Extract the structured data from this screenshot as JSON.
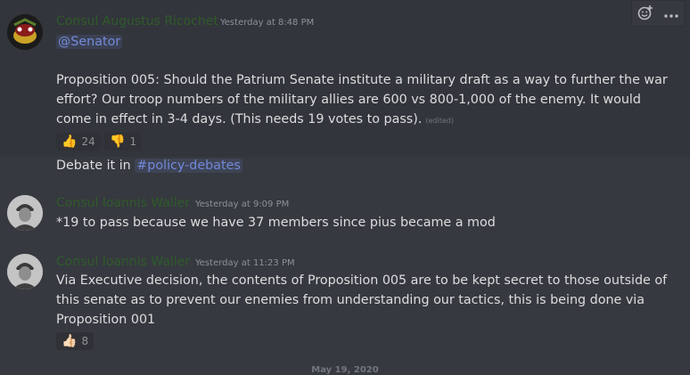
{
  "colors": {
    "background": "#36393f",
    "accent": "#7289da",
    "name_color": "#2f5b2a"
  },
  "toolbar": {
    "add_reaction_icon": "emoji-add-icon",
    "more_icon": "more-options-icon"
  },
  "messages": [
    {
      "author": "Consul Augustus Ricochet",
      "timestamp": "Yesterday at 8:48 PM",
      "mention": "@Senator",
      "body": "Proposition 005: Should the Patrium Senate institute a military draft as a way to further the war effort? Our troop numbers of the military allies are 600 vs 800-1,000 of the enemy. It would come in effect in 3-4 days. (This needs 19 votes to pass).",
      "edited": "(edited)",
      "reactions": [
        {
          "emoji": "thumbs-up",
          "glyph": "👍",
          "count": "24"
        },
        {
          "emoji": "thumbs-down",
          "glyph": "👎",
          "count": "1"
        }
      ],
      "followup_prefix": "Debate it in ",
      "followup_channel": "#policy-debates"
    },
    {
      "author": "Consul Ioannis Waller",
      "timestamp": "Yesterday at 9:09 PM",
      "body": "*19 to pass because we have 37 members since pius became a mod"
    },
    {
      "author": "Consul Ioannis Waller",
      "timestamp": "Yesterday at 11:23 PM",
      "body": "Via Executive decision, the contents of Proposition 005 are to be kept secret to those outside of this senate as to prevent our enemies from understanding our tactics, this is being done via Proposition 001",
      "reactions": [
        {
          "emoji": "thumbs-up-light",
          "glyph": "👍🏻",
          "count": "8"
        }
      ]
    }
  ],
  "date_divider": "May 19, 2020"
}
